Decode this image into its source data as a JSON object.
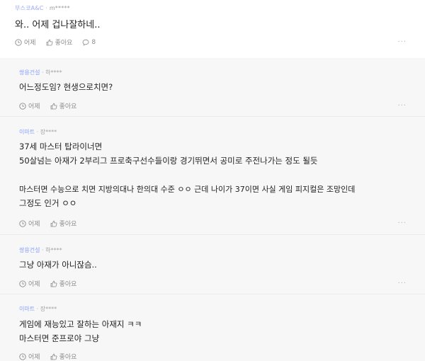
{
  "top_comment": {
    "brand": "부스코A&C",
    "separator": " · ",
    "nickname": "m*****",
    "text": "와.. 어제 겁나잘하네..",
    "time": "어제",
    "like_label": "좋아요",
    "reply_count": "8",
    "more": "···"
  },
  "replies": [
    {
      "brand": "쌍용건설",
      "separator": " · ",
      "nickname": "하****",
      "lines": [
        "어느정도임? 현생으로치면?"
      ],
      "time": "어제",
      "like_label": "좋아요",
      "more": "···"
    },
    {
      "brand": "이마트",
      "separator": " · ",
      "nickname": "장****",
      "lines": [
        "37세 마스터 탑라이너면",
        "50살넘는 아재가 2부리그 프로축구선수들이랑 경기뛰면서 공미로 주전나가는 정도 될듯",
        "",
        "마스터면 수능으로 치면 지방의대나 한의대 수준 ㅇㅇ 근데 나이가 37이면 사실 게임 피지컬은 조망인데",
        "그정도 인거 ㅇㅇ"
      ],
      "time": "어제",
      "like_label": "좋아요",
      "more": "···"
    },
    {
      "brand": "쌍용건설",
      "separator": " · ",
      "nickname": "하****",
      "lines": [
        "그냥 아재가 아니잖슴.."
      ],
      "time": "어제",
      "like_label": "좋아요",
      "more": "···"
    },
    {
      "brand": "이마트",
      "separator": " · ",
      "nickname": "장****",
      "lines": [
        "게임에 재능있고 잘하는 아재지 ㅋㅋ",
        "마스터면 준프로야 그냥"
      ],
      "time": "어제",
      "like_label": "좋아요",
      "more": "···"
    }
  ],
  "colors": {
    "brand": "#8aa0ff",
    "reply_background": "#f7f7f8",
    "meta_text": "#8c8c8c"
  },
  "icons": {
    "time": "clock-icon",
    "like": "thumbs-up-icon",
    "comment": "speech-bubble-icon",
    "more": "more-dots-icon"
  }
}
